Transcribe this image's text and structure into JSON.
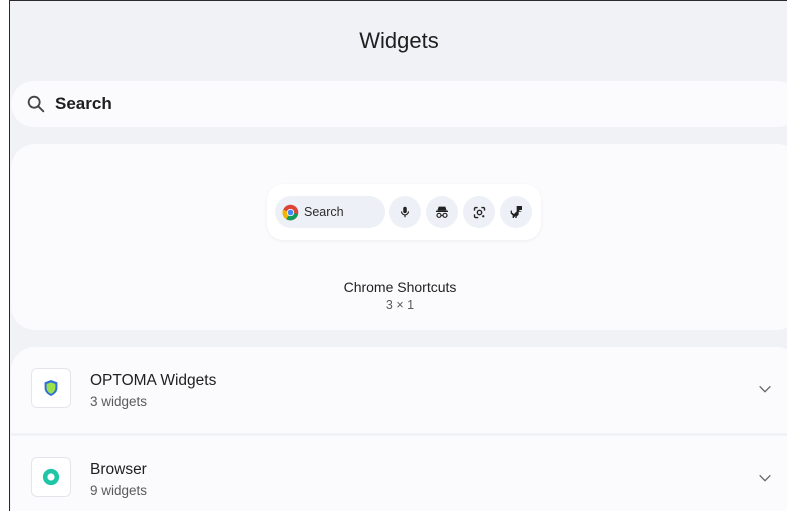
{
  "header": {
    "title": "Widgets"
  },
  "search": {
    "label": "Search"
  },
  "featured": {
    "preview_search_label": "Search",
    "name": "Chrome Shortcuts",
    "size": "3 × 1",
    "icons": [
      "chrome-icon",
      "microphone-icon",
      "incognito-icon",
      "lens-icon",
      "dino-icon"
    ]
  },
  "apps": [
    {
      "name": "OPTOMA Widgets",
      "count": "3 widgets",
      "icon": "shield-icon",
      "expanded": false
    },
    {
      "name": "Browser",
      "count": "9 widgets",
      "icon": "browser-ring-icon",
      "expanded": false
    }
  ],
  "colors": {
    "background": "#f1f2f6",
    "card": "#fbfbfd",
    "optoma_blue": "#2f6fd8",
    "optoma_green": "#9be04d",
    "browser_teal": "#1ec5a6"
  }
}
